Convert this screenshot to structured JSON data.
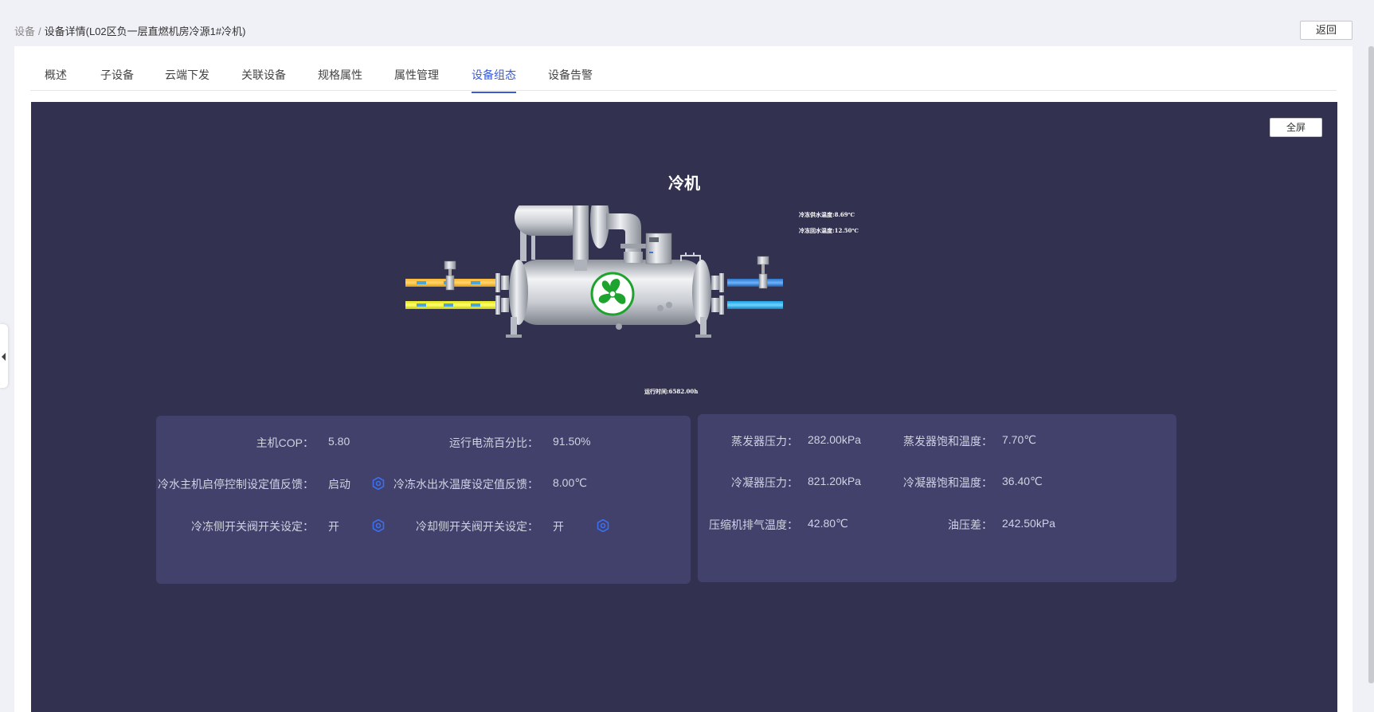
{
  "breadcrumb": {
    "root": "设备",
    "separator": "/",
    "current": "设备详情(L02区负一层直燃机房冷源1#冷机)"
  },
  "header": {
    "back_label": "返回"
  },
  "tabs": [
    {
      "label": "概述"
    },
    {
      "label": "子设备"
    },
    {
      "label": "云端下发"
    },
    {
      "label": "关联设备"
    },
    {
      "label": "规格属性"
    },
    {
      "label": "属性管理"
    },
    {
      "label": "设备组态",
      "active": true
    },
    {
      "label": "设备告警"
    }
  ],
  "stage": {
    "fullscreen_label": "全屏",
    "title": "冷机",
    "supply_temp_label": "冷冻供水温度:8.69℃",
    "return_temp_label": "冷冻回水温度:12.50℃",
    "runtime_label": "运行时间:6582.00h"
  },
  "card_left": {
    "rows": [
      [
        {
          "label": "主机COP：",
          "value": "5.80"
        },
        {
          "label": "运行电流百分比：",
          "value": "91.50%"
        }
      ],
      [
        {
          "label": "冷水主机启停控制设定值反馈：",
          "value": "启动",
          "icon": "gear-icon"
        },
        {
          "label": "冷冻水出水温度设定值反馈：",
          "value": "8.00℃"
        }
      ],
      [
        {
          "label": "冷冻侧开关阀开关设定：",
          "value": "开",
          "icon": "gear-icon"
        },
        {
          "label": "冷却侧开关阀开关设定：",
          "value": "开",
          "icon": "gear-icon"
        }
      ]
    ]
  },
  "card_right": {
    "rows": [
      [
        {
          "label": "蒸发器压力：",
          "value": "282.00kPa"
        },
        {
          "label": "蒸发器饱和温度：",
          "value": "7.70℃"
        }
      ],
      [
        {
          "label": "冷凝器压力：",
          "value": "821.20kPa"
        },
        {
          "label": "冷凝器饱和温度：",
          "value": "36.40℃"
        }
      ],
      [
        {
          "label": "压缩机排气温度：",
          "value": "42.80℃"
        },
        {
          "label": "油压差：",
          "value": "242.50kPa"
        }
      ]
    ]
  },
  "colors": {
    "stage_bg": "#323250",
    "card_bg": "#41416b",
    "accent": "#3b5bd6",
    "fan_green": "#1fa32f"
  }
}
